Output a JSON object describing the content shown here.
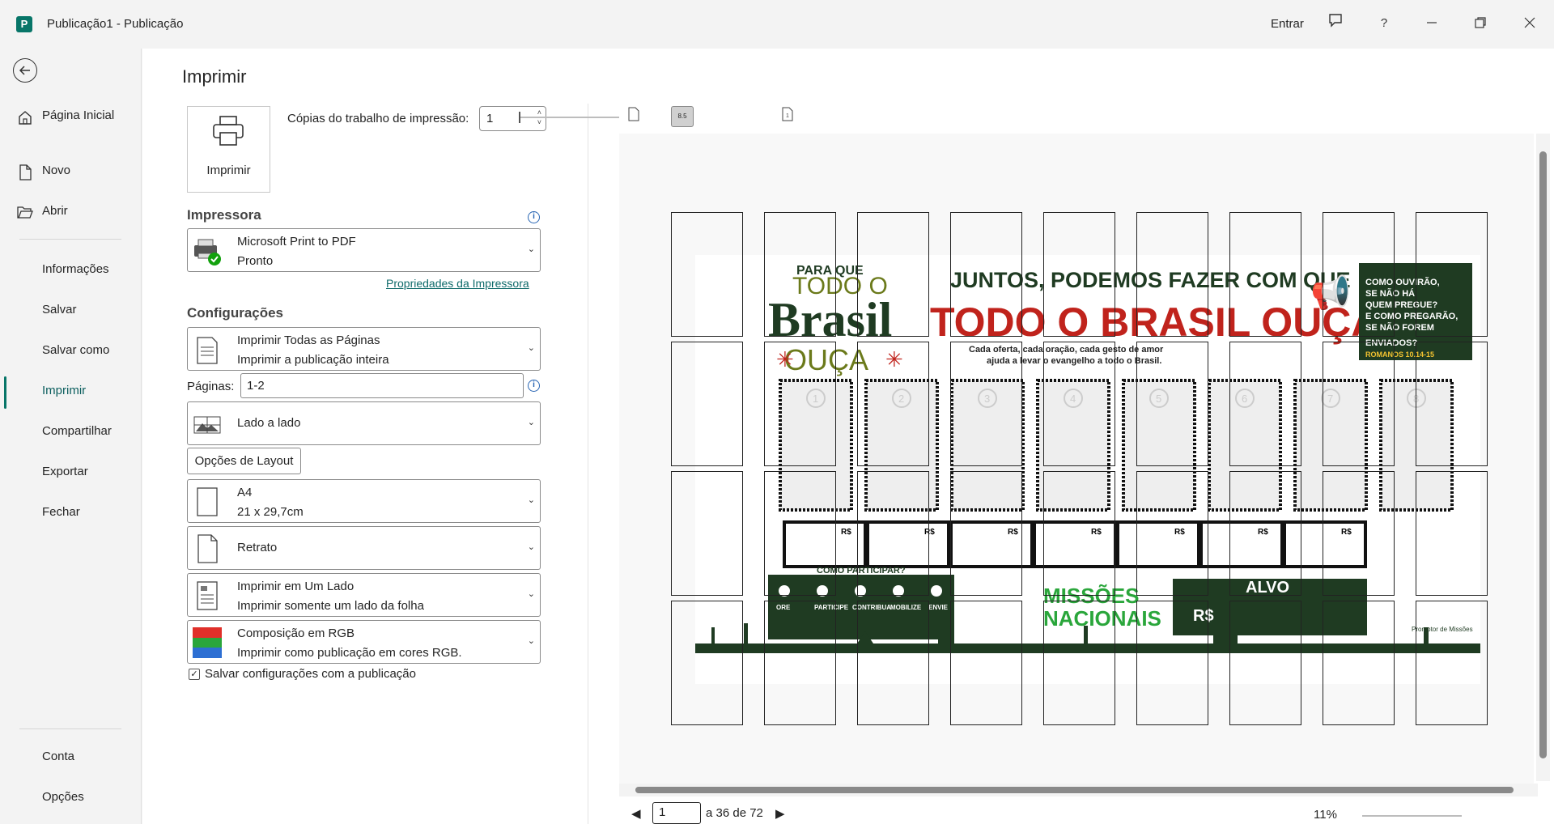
{
  "window": {
    "app_icon": "P",
    "title": "Publicação1  -  Publicação",
    "signin": "Entrar",
    "icons": [
      "feedback-icon",
      "help-icon",
      "minimize-icon",
      "restore-icon",
      "close-icon"
    ],
    "help_label": "?"
  },
  "sidebar": {
    "items": [
      {
        "label": "Página Inicial",
        "icon": "home-icon"
      },
      {
        "label": "Novo",
        "icon": "new-doc-icon"
      },
      {
        "label": "Abrir",
        "icon": "folder-open-icon"
      },
      {
        "label": "Informações"
      },
      {
        "label": "Salvar"
      },
      {
        "label": "Salvar como"
      },
      {
        "label": "Imprimir",
        "selected": true
      },
      {
        "label": "Compartilhar"
      },
      {
        "label": "Exportar"
      },
      {
        "label": "Fechar"
      },
      {
        "label": "Conta"
      },
      {
        "label": "Opções"
      }
    ]
  },
  "print": {
    "title": "Imprimir",
    "print_button": "Imprimir",
    "copies_label": "Cópias do trabalho de impressão:",
    "copies_value": "1",
    "printer_heading": "Impressora",
    "printer_name": "Microsoft Print to PDF",
    "printer_status": "Pronto",
    "printer_properties": "Propriedades da Impressora",
    "settings_heading": "Configurações",
    "range_title": "Imprimir Todas as Páginas",
    "range_desc": "Imprimir a publicação inteira",
    "pages_label": "Páginas:",
    "pages_value": "1-2",
    "layout_title": "Lado a lado",
    "layout_options": "Opções de Layout",
    "paper_title": "A4",
    "paper_desc": "21 x 29,7cm",
    "orientation": "Retrato",
    "sides_title": "Imprimir em Um Lado",
    "sides_desc": "Imprimir somente um lado da folha",
    "color_title": "Composição em RGB",
    "color_desc": "Imprimir como publicação em cores RGB.",
    "save_settings": "Salvar configurações com a publicação",
    "save_settings_checked": true
  },
  "preview": {
    "scale_button": "8.5",
    "poster": {
      "heading_small": "PARA QUE",
      "todo": "TODO O",
      "brasil": "Brasil",
      "ouca": "OUÇA",
      "main_line1": "JUNTOS, PODEMOS FAZER COM QUE",
      "main_line2": "TODO O BRASIL OUÇA!",
      "sub_line1": "Cada oferta, cada oração, cada gesto de amor",
      "sub_line2": "ajuda a levar o evangelho a todo o Brasil.",
      "side_text": "COMO OUVIRÃO, SE NÃO HÁ QUEM PREGUE? E COMO PREGARÃO, SE NÃO FOREM ENVIADOS?",
      "side_ref": "ROMANOS 10.14-15",
      "numbers": [
        "1",
        "2",
        "3",
        "4",
        "5",
        "6",
        "7",
        "8"
      ],
      "currency": "R$",
      "how": "COMO PARTICIPAR?",
      "steps": [
        "ORE",
        "PARTICIPE",
        "CONTRIBUA",
        "MOBILIZE",
        "ENVIE"
      ],
      "brand1": "MISSÕES",
      "brand2": "NACIONAIS",
      "goal": "ALVO",
      "goal_currency": "R$",
      "promoter": "Promotor de Missões"
    }
  },
  "footer": {
    "page_current": "1",
    "page_of": "a 36 de 72",
    "zoom": "11%"
  },
  "colors": {
    "accent": "#077568",
    "poster_green": "#1f3b22",
    "poster_red": "#c0231c",
    "poster_olive": "#6b7a1b"
  }
}
